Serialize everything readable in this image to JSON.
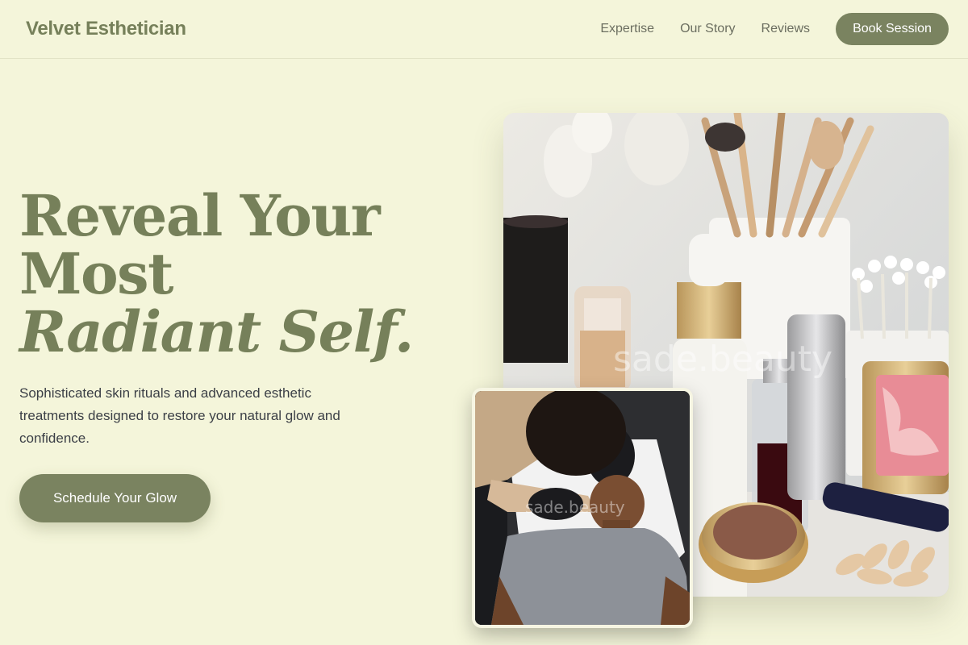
{
  "header": {
    "brand": "Velvet Esthetician",
    "nav": [
      "Expertise",
      "Our Story",
      "Reviews"
    ],
    "book_label": "Book Session"
  },
  "hero": {
    "title_line1": "Reveal Your",
    "title_line2": "Most",
    "title_line3": "Radiant Self.",
    "subtitle": "Sophisticated skin rituals and advanced esthetic treatments designed to restore your natural glow and confidence.",
    "cta_label": "Schedule Your Glow"
  },
  "images": {
    "main_watermark": "sade.beauty",
    "overlay_watermark": "sade.beauty"
  },
  "colors": {
    "background": "#f4f5da",
    "accent": "#7a8360",
    "brand_text": "#76805a"
  }
}
